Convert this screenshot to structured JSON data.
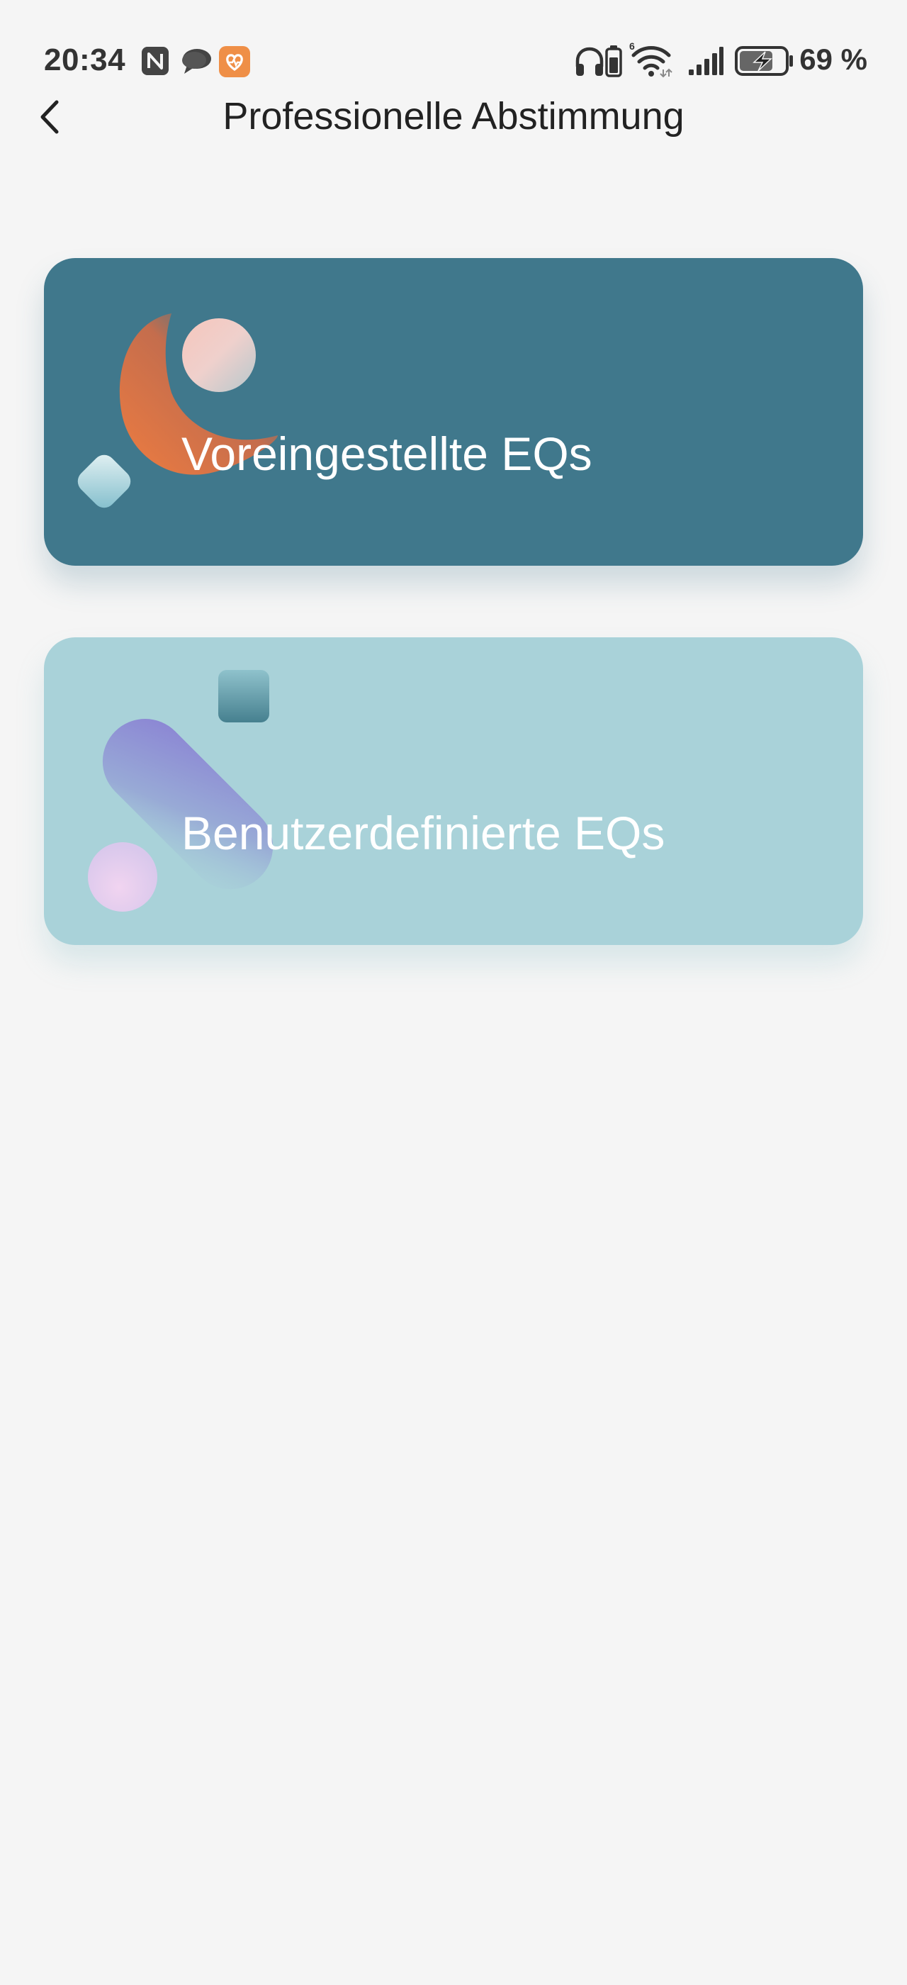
{
  "status_bar": {
    "time": "20:34",
    "battery_percent": "69 %",
    "left_icons": [
      "nfc-icon",
      "chat-bubble-icon",
      "health-app-icon"
    ],
    "right_icons": [
      "headphones-icon",
      "headphone-battery-icon",
      "wifi-6-icon",
      "cellular-signal-icon",
      "battery-charging-icon"
    ]
  },
  "header": {
    "title": "Professionelle Abstimmung",
    "back_icon": "chevron-left-icon"
  },
  "cards": [
    {
      "label": "Voreingestellte EQs",
      "background": "#40788c",
      "accent": "#e07a48"
    },
    {
      "label": "Benutzerdefinierte EQs",
      "background": "#a9d2d9",
      "accent": "#8c86d4"
    }
  ],
  "colors": {
    "page_background": "#f5f5f5",
    "title_text": "#222222",
    "card_text": "#ffffff"
  }
}
